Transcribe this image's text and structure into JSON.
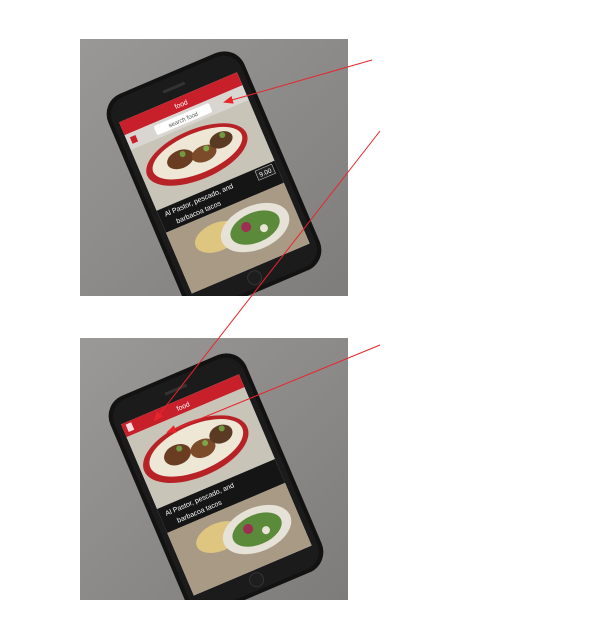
{
  "photo_top": {
    "app_title": "food",
    "search_placeholder": "search food",
    "item_name_line1": "Al Pastor, pescado, and",
    "item_name_line2": "barbacoa tacos",
    "item_price": "9.00"
  },
  "photo_bottom": {
    "app_title": "food",
    "item_name_line1": "Al Pastor, pescado, and",
    "item_name_line2": "barbacoa tacos"
  },
  "colors": {
    "brand_red": "#c8202a",
    "annotation_red": "#e8252b",
    "phone_body": "#151515"
  }
}
